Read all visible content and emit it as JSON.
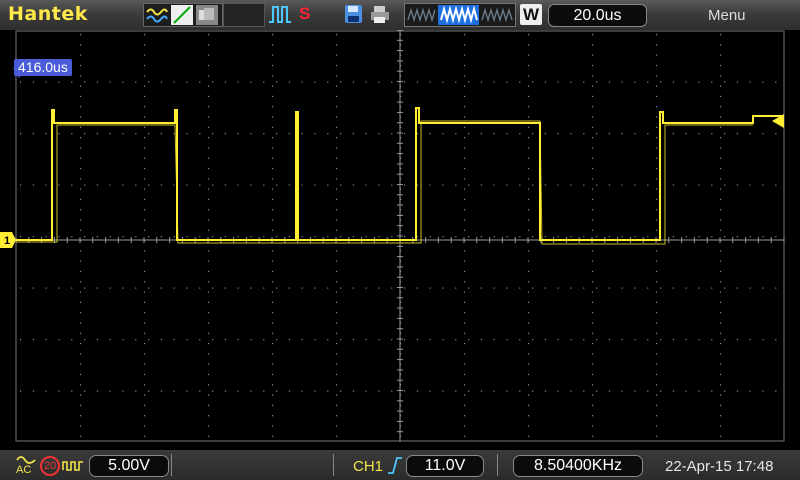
{
  "header": {
    "brand": "Hantek",
    "timebase": "20.0us",
    "w_label": "W",
    "menu_label": "Menu",
    "stop_label": "S"
  },
  "screen": {
    "trigger_offset": "416.0us",
    "ch1_marker": "1"
  },
  "footer": {
    "coupling": "AC",
    "bandwidth_limit": "20",
    "ch1_volts_div": "5.00V",
    "trigger_source": "CH1",
    "trigger_level": "11.0V",
    "frequency": "8.50400KHz",
    "datetime": "22-Apr-15 17:48"
  },
  "colors": {
    "trace": "#ffee33",
    "brand": "#ffe94a",
    "offset_badge": "#4a5cd8",
    "grid": "#8a8a8a"
  },
  "icons": [
    "waveform-mode-icon",
    "line-mode-icon",
    "persist-mode-icon",
    "pulse-trigger-icon",
    "save-icon",
    "print-icon",
    "rising-edge-icon"
  ]
}
